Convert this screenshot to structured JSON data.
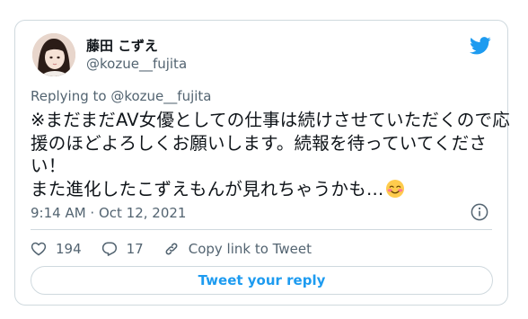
{
  "author": {
    "display_name": "藤田 こずえ",
    "handle": "@kozue__fujita"
  },
  "reply_context": {
    "prefix": "Replying to ",
    "mention": "@kozue__fujita"
  },
  "tweet": {
    "lines": [
      "※まだまだAV女優としての仕事は続けさせていただくので応",
      "援のほどよろしくお願いします。続報を待っていてくださ",
      "い！",
      "また進化したこずえもんが見れちゃうかも…"
    ],
    "emoji": "smiling-face-with-blush"
  },
  "timestamp": "9:14 AM · Oct 12, 2021",
  "actions": {
    "like_count": "194",
    "reply_count": "17",
    "copy_link_label": "Copy link to Tweet"
  },
  "reply_button_label": "Tweet your reply",
  "colors": {
    "twitter_blue": "#1d9bf0",
    "text_primary": "#0f1419",
    "text_secondary": "#536471",
    "border": "#cfd9de"
  },
  "icons": [
    "twitter-bird-icon",
    "info-icon",
    "heart-icon",
    "reply-icon",
    "link-icon"
  ]
}
